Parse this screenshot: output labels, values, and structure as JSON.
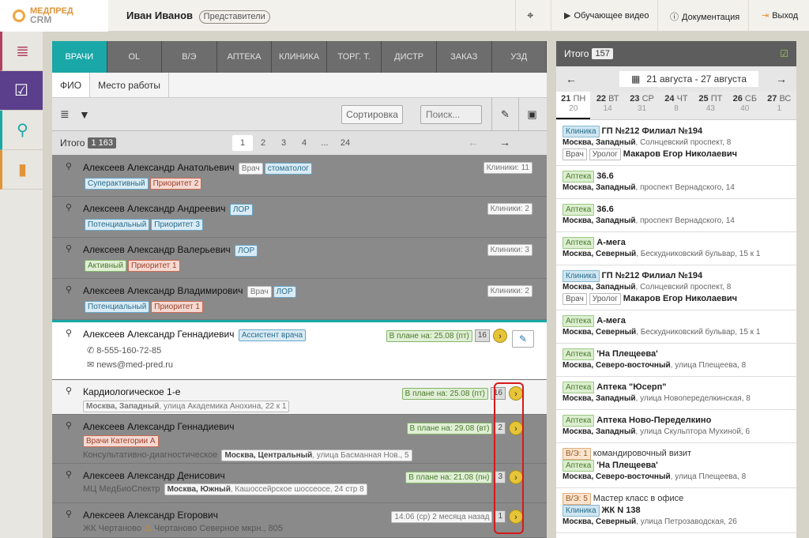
{
  "app": {
    "logo_line1": "МЕДПРЕД",
    "logo_line2": "CRM"
  },
  "header": {
    "user_name": "Иван Иванов",
    "user_role": "Представители",
    "video_label": "Обучающее видео",
    "docs_label": "Документация",
    "exit_label": "Выход"
  },
  "tabs": [
    "ВРАЧИ",
    "OL",
    "В/Э",
    "АПТЕКА",
    "КЛИНИКА",
    "ТОРГ. Т.",
    "ДИСТР",
    "ЗАКАЗ",
    "УЗД"
  ],
  "subtabs": [
    "ФИО",
    "Место работы"
  ],
  "toolbar": {
    "sort_label": "Сортировка",
    "search_placeholder": "Поиск..."
  },
  "pager": {
    "total_label": "Итого",
    "total_count": "1 163",
    "pages": [
      "1",
      "2",
      "3",
      "4",
      "...",
      "24"
    ]
  },
  "rows": [
    {
      "name": "Алексеев Александр Анатольевич",
      "tags": [
        "Врач",
        "стоматолог"
      ],
      "tags2": [
        "Суперактивный",
        "Приоритет 2"
      ],
      "right": "Клиники: 11"
    },
    {
      "name": "Алексеев Александр Андреевич",
      "tags": [
        "ЛОР"
      ],
      "tags2": [
        "Потенциальный",
        "Приоритет 3"
      ],
      "right": "Клиники: 2"
    },
    {
      "name": "Алексеев Александр Валерьевич",
      "tags": [
        "ЛОР"
      ],
      "tags2": [
        "Активный",
        "Приоритет 1"
      ],
      "right": "Клиники: 3"
    },
    {
      "name": "Алексеев Александр Владимирович",
      "tags": [
        "Врач",
        "ЛОР"
      ],
      "tags2": [
        "Потенциальный",
        "Приоритет 1"
      ],
      "right": "Клиники: 2"
    },
    {
      "name": "Алексеев Александр Геннадиевич",
      "tags": [
        "Ассистент врача"
      ],
      "phone": "8-555-160-72-85",
      "email": "news@med-pred.ru",
      "plan": "В плане на: 25.08 (пт)",
      "num": "16"
    },
    {
      "name": "Кардиологическое 1-е",
      "sub_bold": "Москва, Западный",
      "sub_rest": ", улица Академика Анохина, 22 к 1",
      "plan": "В плане на: 25.08 (пт)",
      "num": "16"
    },
    {
      "name": "Алексеев Александр Геннадиевич",
      "tag_red": "Врачи Категории А",
      "sub_pre": "Консультативно-диагностическое",
      "sub_bold": "Москва, Центральный",
      "sub_rest": ", улица Басманная Нов., 5",
      "plan": "В плане на: 29.08 (вт)",
      "num": "2"
    },
    {
      "name": "Алексеев Александр Денисович",
      "sub_pre": "МЦ МедБиоСпектр",
      "sub_bold": "Москва, Южный",
      "sub_rest": ", Кашоссейрское шоссеосе, 24 стр 8",
      "plan": "В плане на: 21.08 (пн)",
      "num": "3"
    },
    {
      "name": "Алексеев Александр Егорович",
      "sub_pre": "ЖК Чертаново",
      "sub_rest": "Чертаново Северное мкрн., 805",
      "plan": "14.06 (ср) 2 месяца назад",
      "num": "1"
    }
  ],
  "right_panel": {
    "total_label": "Итого",
    "total_count": "157",
    "date_range": "21 августа - 27 августа",
    "days": [
      {
        "d": "21",
        "w": "ПН",
        "c": "20"
      },
      {
        "d": "22",
        "w": "ВТ",
        "c": "14"
      },
      {
        "d": "23",
        "w": "СР",
        "c": "31"
      },
      {
        "d": "24",
        "w": "ЧТ",
        "c": "8"
      },
      {
        "d": "25",
        "w": "ПТ",
        "c": "43"
      },
      {
        "d": "26",
        "w": "СБ",
        "c": "40"
      },
      {
        "d": "27",
        "w": "ВС",
        "c": "1"
      }
    ],
    "items": [
      {
        "type": "Клиника",
        "title": "ГП №212 Филиал №194",
        "addr_b": "Москва, Западный",
        "addr": ", Солнцевский проспект, 8",
        "extra": [
          "Врач",
          "Уролог"
        ],
        "person": "Макаров Егор Николаевич"
      },
      {
        "type": "Аптека",
        "title": "36.6",
        "addr_b": "Москва, Западный",
        "addr": ", проспект Вернадского, 14"
      },
      {
        "type": "Аптека",
        "title": "36.6",
        "addr_b": "Москва, Западный",
        "addr": ", проспект Вернадского, 14"
      },
      {
        "type": "Аптека",
        "title": "А-мега",
        "addr_b": "Москва, Северный",
        "addr": ", Бескудниковский бульвар, 15 к 1"
      },
      {
        "type": "Клиника",
        "title": "ГП №212 Филиал №194",
        "addr_b": "Москва, Западный",
        "addr": ", Солнцевский проспект, 8",
        "extra": [
          "Врач",
          "Уролог"
        ],
        "person": "Макаров Егор Николаевич"
      },
      {
        "type": "Аптека",
        "title": "А-мега",
        "addr_b": "Москва, Северный",
        "addr": ", Бескудниковский бульвар, 15 к 1"
      },
      {
        "type": "Аптека",
        "title": "'На Плещеева'",
        "addr_b": "Москва, Северо-восточный",
        "addr": ", улица Плещеева, 8"
      },
      {
        "type": "Аптека",
        "title": "Аптека \"Юсерп\"",
        "addr_b": "Москва, Западный",
        "addr": ", улица Новопеределкинская, 8"
      },
      {
        "type": "Аптека",
        "title": "Аптека Ново-Переделкино",
        "addr_b": "Москва, Западный",
        "addr": ", улица Скульптора Мухиной, 6"
      },
      {
        "vz": "В/Э: 1",
        "vz_title": "командировочный визит",
        "type": "Аптека",
        "title": "'На Плещеева'",
        "addr_b": "Москва, Северо-восточный",
        "addr": ", улица Плещеева, 8"
      },
      {
        "vz": "В/Э: 5",
        "vz_title": "Мастер класс в офисе",
        "type": "Клиника",
        "title": "ЖК N 138",
        "addr_b": "Москва, Северный",
        "addr": ", улица Петрозаводская, 26"
      }
    ]
  },
  "colors": {
    "accent": "#1aa7a7",
    "logo": "#e0943a",
    "highlight": "#d71919"
  }
}
